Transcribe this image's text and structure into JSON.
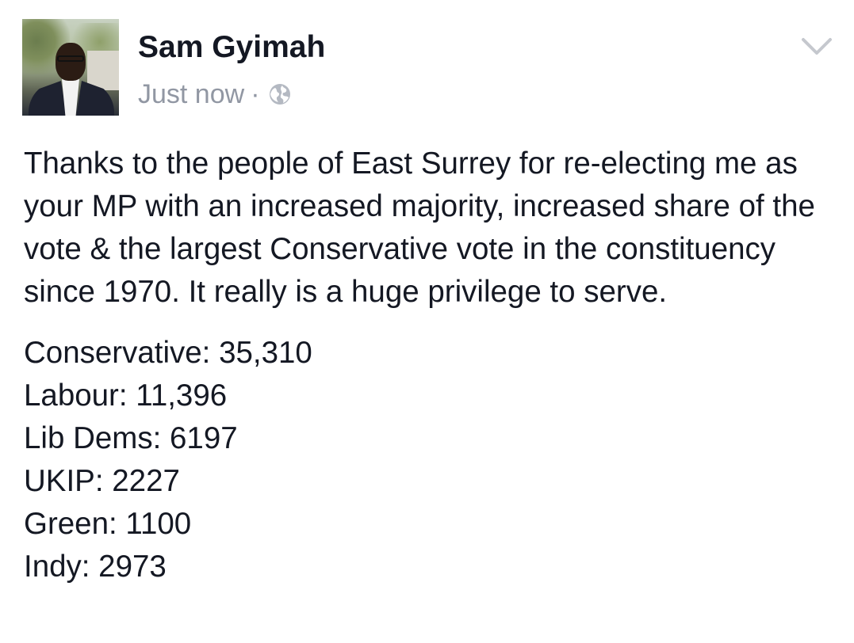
{
  "post": {
    "author": "Sam Gyimah",
    "timestamp": "Just now",
    "separator": "·",
    "privacy_icon": "globe-icon",
    "menu_icon": "chevron-down-icon",
    "message": "Thanks to the people of East Surrey for re-electing me as your MP with an increased majority, increased share of the vote & the largest Conservative vote in the constituency since 1970. It really is a huge privilege to serve.",
    "results": [
      "Conservative: 35,310",
      "Labour: 11,396",
      "Lib Dems: 6197",
      "UKIP: 2227",
      "Green: 1100",
      "Indy: 2973"
    ]
  },
  "colors": {
    "text": "#141823",
    "meta": "#9197a3",
    "background": "#ffffff"
  }
}
